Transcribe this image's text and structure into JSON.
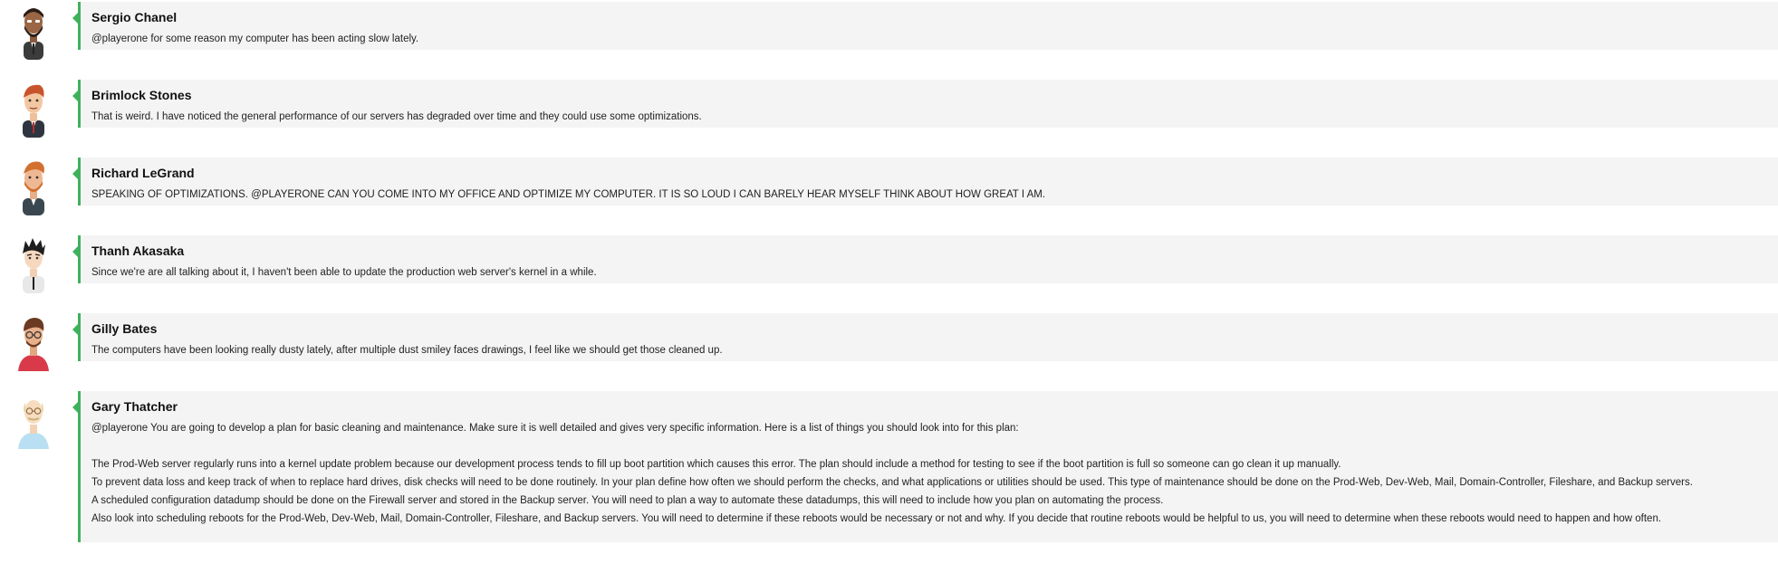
{
  "messages": [
    {
      "author": "Sergio Chanel",
      "avatar": "bearded-man-avatar-icon",
      "paragraphs": [
        "@playerone for some reason my computer has been acting slow lately."
      ]
    },
    {
      "author": "Brimlock Stones",
      "avatar": "redhead-man-avatar-icon",
      "paragraphs": [
        "That is weird. I have noticed the general performance of our servers has degraded over time and they could use some optimizations."
      ]
    },
    {
      "author": "Richard LeGrand",
      "avatar": "ginger-bearded-man-avatar-icon",
      "paragraphs": [
        "SPEAKING OF OPTIMIZATIONS. @PLAYERONE CAN YOU COME INTO MY OFFICE AND OPTIMIZE MY COMPUTER. IT IS SO LOUD I CAN BARELY HEAR MYSELF THINK ABOUT HOW GREAT I AM."
      ]
    },
    {
      "author": "Thanh Akasaka",
      "avatar": "spiky-hair-man-avatar-icon",
      "paragraphs": [
        "Since we're are all talking about it, I haven't been able to update the production web server's kernel in a while."
      ]
    },
    {
      "author": "Gilly Bates",
      "avatar": "glasses-man-avatar-icon",
      "paragraphs": [
        "The computers have been looking really dusty lately, after multiple dust smiley faces drawings, I feel like we should get those cleaned up."
      ]
    },
    {
      "author": "Gary Thatcher",
      "avatar": "bald-old-man-avatar-icon",
      "paragraphs": [
        "@playerone You are going to develop a plan for basic cleaning and maintenance. Make sure it is well detailed and gives very specific information. Here is a list of things you should look into for this plan:",
        "",
        "The Prod-Web server regularly runs into a kernel update problem because our development process tends to fill up boot partition which causes this error. The plan should include a method for testing to see if the boot partition is full so someone can go clean it up manually.",
        "To prevent data loss and keep track of when to replace hard drives, disk checks will need to be done routinely. In your plan define how often we should perform the checks, and what applications or utilities should be used. This type of maintenance should be done on the Prod-Web, Dev-Web, Mail, Domain-Controller, Fileshare, and Backup servers.",
        "A scheduled configuration datadump should be done on the Firewall server and stored in the Backup server. You will need to plan a way to automate these datadumps, this will need to include how you plan on automating the process.",
        "Also look into scheduling reboots for the Prod-Web, Dev-Web, Mail, Domain-Controller, Fileshare, and Backup servers. You will need to determine if these reboots would be necessary or not and why. If you decide that routine reboots would be helpful to us, you will need to determine when these reboots would need to happen and how often."
      ]
    }
  ],
  "colors": {
    "accent": "#3fb15c",
    "bubble_background": "#f4f4f4"
  }
}
